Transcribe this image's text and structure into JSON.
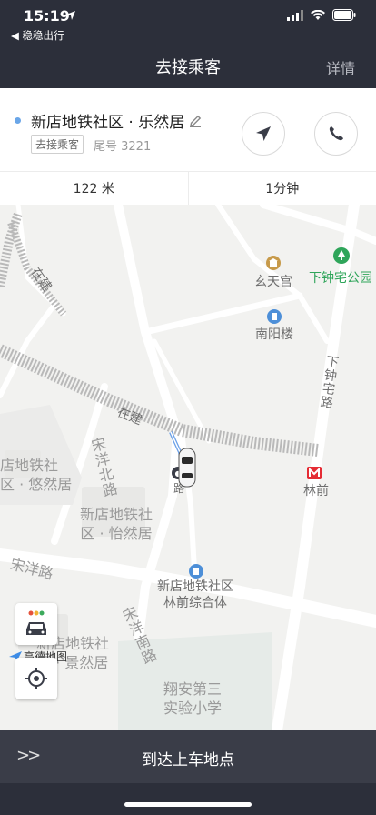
{
  "status_bar": {
    "time": "15:19",
    "back_app": "◀ 稳稳出行"
  },
  "nav": {
    "title": "去接乘客",
    "detail": "详情"
  },
  "card": {
    "destination": "新店地铁社区 · 乐然居",
    "tag": "去接乘客",
    "tail_number": "尾号 3221",
    "distance": "122 米",
    "duration": "1分钟"
  },
  "map": {
    "labels": {
      "xuantiangong": "玄天宫",
      "xiazhongzhai_park": "下钟宅公园",
      "nanyanglou": "南阳楼",
      "xiazhongzhai_road": "下钟宅路",
      "zaijian_road_left": "在建",
      "zaijian_road_mid": "在建",
      "linqian": "林前",
      "songyang_north": "宋洋北路",
      "yiranju": "新店地铁社\n区 · 怡然居",
      "youranju_part": "店地铁社\n区 · 悠然居",
      "songyang_road": "宋洋路",
      "songyang_south": "宋洋南路",
      "linqian_complex": "新店地铁社区\n林前综合体",
      "jingranju_part": "新店地铁社\n区 · 景然居",
      "school": "翔安第三\n实验小学",
      "road_fragment": "路",
      "logo": "高德地图"
    },
    "colors": {
      "metro": "#e52c34",
      "poi_blue": "#4d8fd8",
      "poi_green": "#2fa55a"
    }
  },
  "bottom": {
    "action": "到达上车地点"
  }
}
